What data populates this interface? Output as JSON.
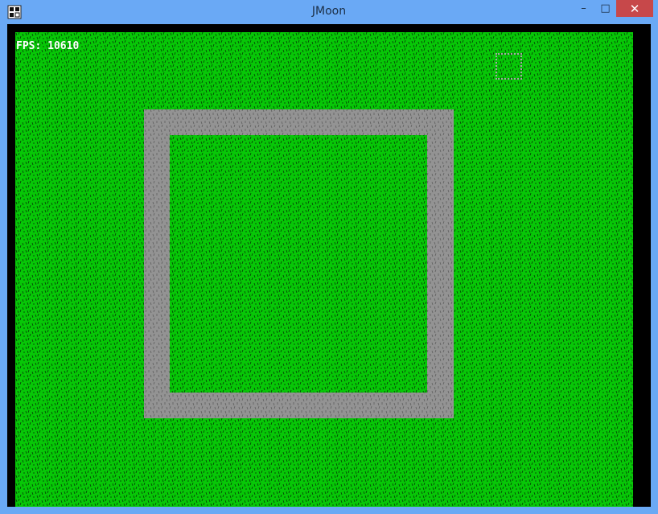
{
  "window": {
    "title": "JMoon"
  },
  "window_controls": {
    "minimize": "–",
    "maximize": "□",
    "close": "✕"
  },
  "hud": {
    "fps": "FPS: 10610"
  },
  "colors": {
    "grass": "#07c707",
    "grass_mark": "#064506",
    "road": "#939393",
    "road_mark": "#5e5e5e",
    "letterbox": "#000000",
    "titlebar": "#6aa9f5"
  },
  "icons": {
    "app": "jmoon-app-icon"
  }
}
